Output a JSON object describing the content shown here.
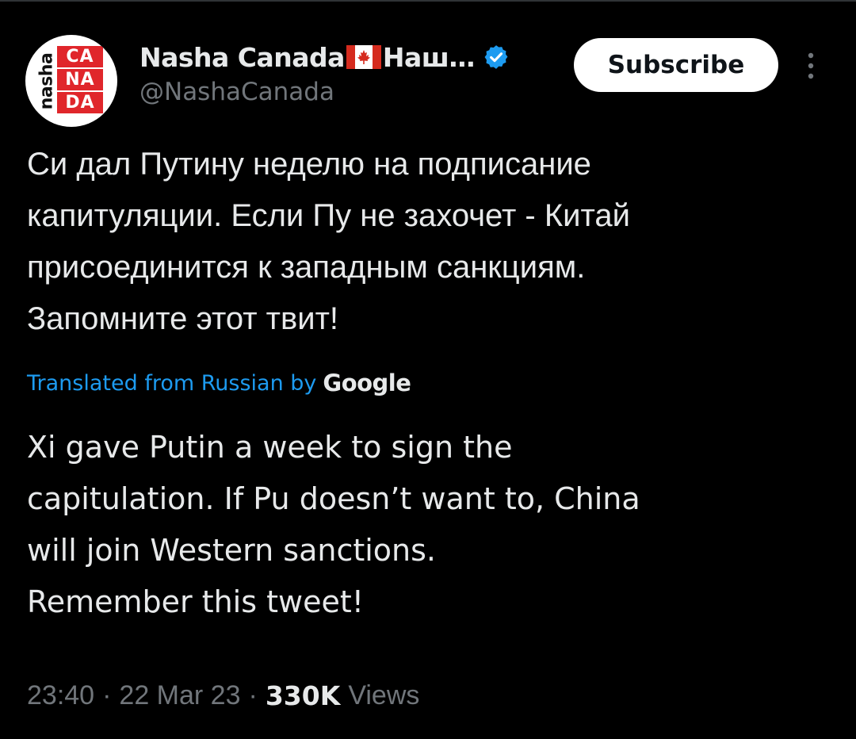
{
  "author": {
    "display_name_part1": "Nasha Canada",
    "display_name_part2": "Наш…",
    "handle": "@NashaCanada",
    "verified": true,
    "avatar": {
      "vertical_text": "nasha",
      "grid_text": [
        "CA",
        "NA",
        "DA"
      ],
      "accent_color": "#e0262b"
    }
  },
  "subscribe_label": "Subscribe",
  "tweet_ru": [
    "Си дал Путину неделю на подписание",
    "капитуляции. Если Пу не захочет - Китай",
    "присоединится к западным санкциям.",
    "Запомните этот твит!"
  ],
  "translation": {
    "label": "Translated from Russian by",
    "provider": "Google"
  },
  "tweet_en": [
    "Xi gave Putin a week to sign the",
    "capitulation. If Pu doesn’t want to, China",
    "will join Western sanctions.",
    "Remember this tweet!"
  ],
  "meta": {
    "time": "23:40",
    "separator": "·",
    "date": "22 Mar 23",
    "views_count": "330K",
    "views_label": "Views"
  },
  "colors": {
    "background": "#000000",
    "text": "#e7e9ea",
    "muted": "#71767b",
    "link": "#1d9bf0"
  }
}
